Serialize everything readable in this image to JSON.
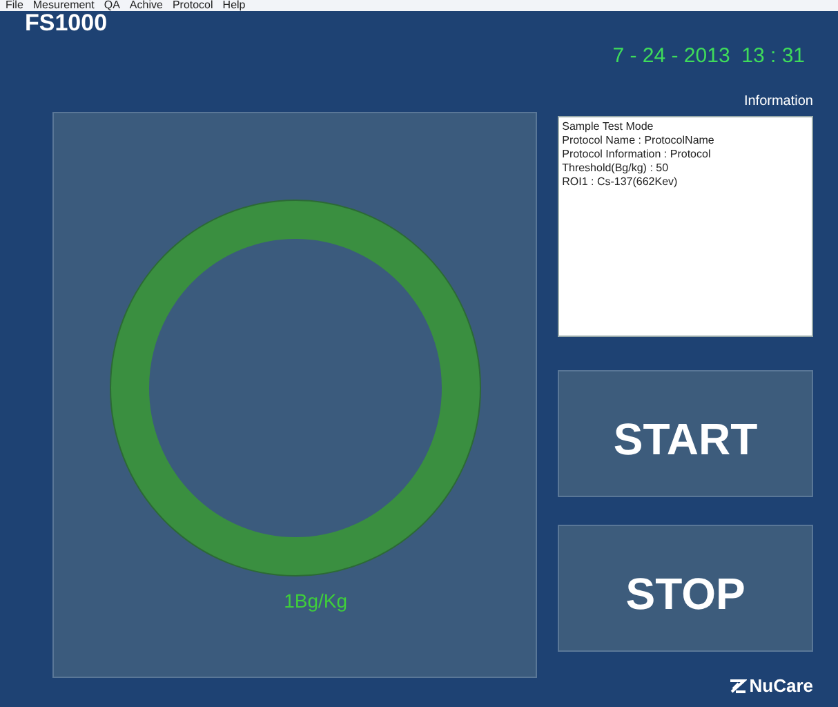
{
  "menu": [
    "File",
    "Mesurement",
    "QA",
    "Achive",
    "Protocol",
    "Help"
  ],
  "app_title": "FS1000",
  "datetime": "7 - 24 - 2013  13 : 31",
  "reading": "1Bg/Kg",
  "information": {
    "label": "Information",
    "lines": [
      "Sample Test Mode",
      "Protocol Name : ProtocolName",
      "Protocol Information : Protocol",
      "Threshold(Bg/kg) : 50",
      "ROI1 : Cs-137(662Kev)"
    ]
  },
  "buttons": [
    "START",
    "STOP"
  ],
  "brand": "NuCare"
}
